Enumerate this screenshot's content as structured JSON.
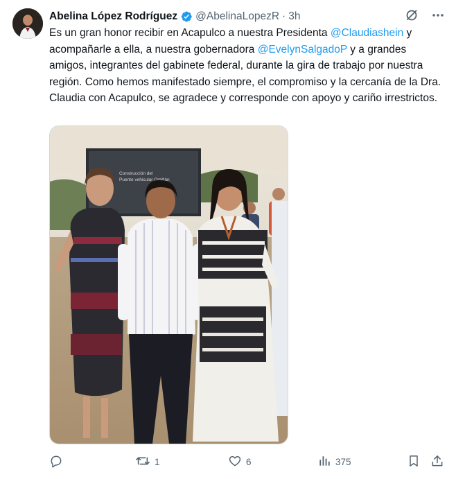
{
  "tweet": {
    "author_name": "Abelina López Rodríguez",
    "handle": "@AbelinaLopezR",
    "separator": "·",
    "time": "3h",
    "text_parts": [
      {
        "type": "text",
        "value": "Es un gran honor recibir en Acapulco a nuestra Presidenta "
      },
      {
        "type": "mention",
        "value": "@Claudiashein"
      },
      {
        "type": "text",
        "value": " y acompañarle a ella, a nuestra gobernadora "
      },
      {
        "type": "mention",
        "value": "@EvelynSalgadoP"
      },
      {
        "type": "text",
        "value": " y a grandes amigos, integrantes del gabinete federal, durante la gira de trabajo por nuestra región. Como hemos manifestado siempre, el compromiso y la cercanía de la Dra. Claudia con Acapulco, se agradece y corresponde con apoyo y cariño irrestrictos."
      }
    ],
    "photo_banner_text": [
      "Construcción del",
      "Puente vehicular Omitlán"
    ]
  },
  "actions": {
    "reply_count": "",
    "retweet_count": "1",
    "like_count": "6",
    "views_count": "375"
  },
  "colors": {
    "text": "#0f1419",
    "secondary": "#536471",
    "accent": "#1d9bf0"
  },
  "icons": [
    "verified-badge-icon",
    "grok-icon",
    "more-icon",
    "reply-icon",
    "retweet-icon",
    "like-icon",
    "views-icon",
    "bookmark-icon",
    "share-icon"
  ]
}
